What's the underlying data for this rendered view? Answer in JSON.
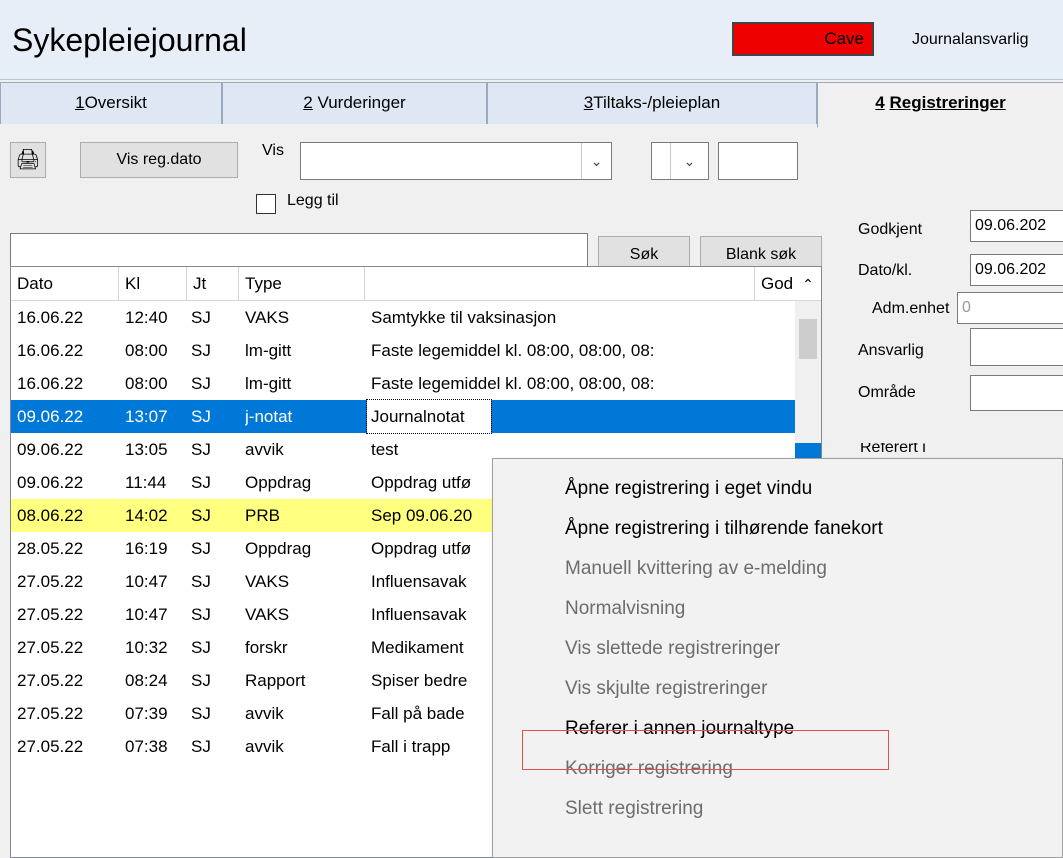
{
  "window": {
    "title": "Sykepleiejournal",
    "cave_label": "Cave",
    "journalansvarlig_label": "Journalansvarlig"
  },
  "tabs": [
    {
      "number": "1",
      "label": "Oversikt"
    },
    {
      "number": "2",
      "label": "Vurderinger"
    },
    {
      "number": "3",
      "label": "Tiltaks-/pleieplan"
    },
    {
      "number": "4",
      "label": "Registreringer",
      "active": true
    }
  ],
  "toolbar": {
    "vis_reg_dato_label": "Vis reg.dato",
    "vis_label": "Vis",
    "vis_value": "",
    "legg_til_label": "Legg til",
    "legg_til_checked": false,
    "search_value": "",
    "sok_label": "Søk",
    "blank_sok_label": "Blank søk"
  },
  "grid": {
    "columns": [
      "Dato",
      "Kl",
      "Jt",
      "Type",
      "",
      "God"
    ],
    "rows": [
      {
        "dato": "16.06.22",
        "kl": "12:40",
        "jt": "SJ",
        "type": "VAKS",
        "text": "Samtykke til vaksinasjon"
      },
      {
        "dato": "16.06.22",
        "kl": "08:00",
        "jt": "SJ",
        "type": "lm-gitt",
        "text": "Faste legemiddel kl. 08:00,  08:00,  08:"
      },
      {
        "dato": "16.06.22",
        "kl": "08:00",
        "jt": "SJ",
        "type": "lm-gitt",
        "text": "Faste legemiddel kl. 08:00,  08:00,  08:"
      },
      {
        "dato": "09.06.22",
        "kl": "13:07",
        "jt": "SJ",
        "type": "j-notat",
        "text": "Journalnotat",
        "selected": true
      },
      {
        "dato": "09.06.22",
        "kl": "13:05",
        "jt": "SJ",
        "type": "avvik",
        "text": "test"
      },
      {
        "dato": "09.06.22",
        "kl": "11:44",
        "jt": "SJ",
        "type": "Oppdrag",
        "text": "Oppdrag utfø"
      },
      {
        "dato": "08.06.22",
        "kl": "14:02",
        "jt": "SJ",
        "type": "PRB",
        "text": "Sep 09.06.20",
        "highlight": true
      },
      {
        "dato": "28.05.22",
        "kl": "16:19",
        "jt": "SJ",
        "type": "Oppdrag",
        "text": "Oppdrag utfø"
      },
      {
        "dato": "27.05.22",
        "kl": "10:47",
        "jt": "SJ",
        "type": "VAKS",
        "text": "Influensavak"
      },
      {
        "dato": "27.05.22",
        "kl": "10:47",
        "jt": "SJ",
        "type": "VAKS",
        "text": "Influensavak"
      },
      {
        "dato": "27.05.22",
        "kl": "10:32",
        "jt": "SJ",
        "type": "forskr",
        "text": "Medikament"
      },
      {
        "dato": "27.05.22",
        "kl": "08:24",
        "jt": "SJ",
        "type": "Rapport",
        "text": "Spiser bedre"
      },
      {
        "dato": "27.05.22",
        "kl": "07:39",
        "jt": "SJ",
        "type": "avvik",
        "text": "Fall på bade"
      },
      {
        "dato": "27.05.22",
        "kl": "07:38",
        "jt": "SJ",
        "type": "avvik",
        "text": "Fall i trapp"
      }
    ]
  },
  "details": {
    "godkjent_label": "Godkjent",
    "godkjent_value": "09.06.202",
    "dato_kl_label": "Dato/kl.",
    "dato_kl_value": "09.06.202",
    "adm_enhet_label": "Adm.enhet",
    "adm_enhet_value": "0",
    "ansvarlig_label": "Ansvarlig",
    "ansvarlig_value": "",
    "omrade_label": "Område",
    "omrade_value": "",
    "referert_label": "Referert i"
  },
  "context_menu": {
    "items": [
      {
        "label": "Åpne registrering i eget vindu",
        "enabled": true
      },
      {
        "label": "Åpne registrering i tilhørende fanekort",
        "enabled": true
      },
      {
        "label": "Manuell kvittering av e-melding",
        "enabled": false
      },
      {
        "label": "Normalvisning",
        "enabled": false
      },
      {
        "label": "Vis slettede registreringer",
        "enabled": false
      },
      {
        "label": "Vis skjulte registreringer",
        "enabled": false
      },
      {
        "label": "Referer i annen journaltype",
        "enabled": true,
        "highlighted": true
      },
      {
        "label": "Korriger registrering",
        "enabled": false
      },
      {
        "label": "Slett registrering",
        "enabled": false
      }
    ]
  },
  "colors": {
    "selection": "#0078d7",
    "highlight_row": "#ffff80",
    "cave": "#ee0000",
    "menu_highlight_border": "#e05050"
  }
}
